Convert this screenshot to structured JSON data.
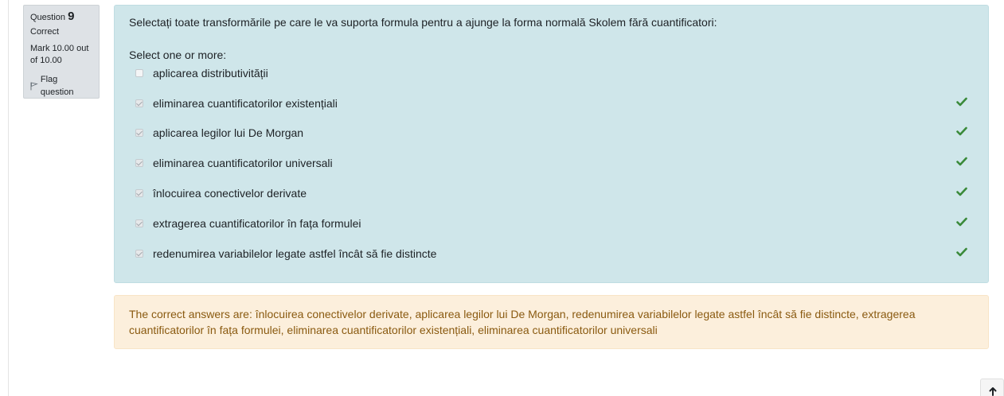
{
  "question_info": {
    "label": "Question",
    "number": "9",
    "state": "Correct",
    "grade": "Mark 10.00 out of 10.00",
    "flag_label": "Flag question"
  },
  "question": {
    "text": "Selectați toate transformările pe care le va suporta formula pentru a ajunge la forma normală Skolem fără cuantificatori:",
    "prompt": "Select one or more:",
    "options": [
      {
        "label": "aplicarea distributivității",
        "checked": false,
        "correct_mark": false
      },
      {
        "label": "eliminarea cuantificatorilor existențiali",
        "checked": true,
        "correct_mark": true
      },
      {
        "label": "aplicarea legilor lui De Morgan",
        "checked": true,
        "correct_mark": true
      },
      {
        "label": "eliminarea cuantificatorilor universali",
        "checked": true,
        "correct_mark": true
      },
      {
        "label": "înlocuirea conectivelor derivate",
        "checked": true,
        "correct_mark": true
      },
      {
        "label": "extragerea cuantificatorilor în fața formulei",
        "checked": true,
        "correct_mark": true
      },
      {
        "label": "redenumirea variabilelor legate astfel încât să fie distincte",
        "checked": true,
        "correct_mark": true
      }
    ]
  },
  "feedback": {
    "text": "The correct answers are: înlocuirea conectivelor derivate, aplicarea legilor lui De Morgan, redenumirea variabilelor legate astfel încât să fie distincte, extragerea cuantificatorilor în fața formulei, eliminarea cuantificatorilor existențiali, eliminarea cuantificatorilor universali"
  },
  "colors": {
    "content_bg": "#cfe6ea",
    "feedback_bg": "#fcefdc",
    "feedback_text": "#8a5a10",
    "tick": "#3a8a3a",
    "info_bg": "#dee2e6"
  },
  "icons": {
    "flag": "flag-icon",
    "tick": "check-icon",
    "scroll_top": "arrow-up-icon"
  }
}
